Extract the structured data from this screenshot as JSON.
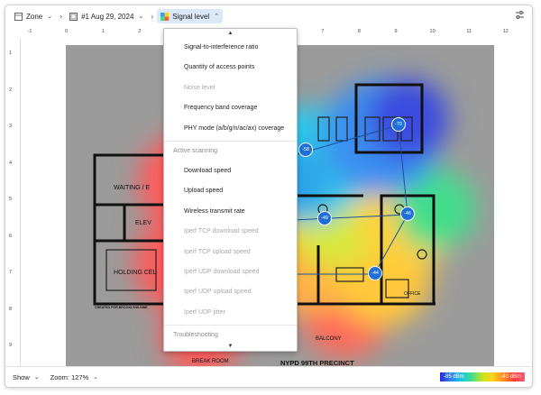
{
  "toolbar": {
    "zone_label": "Zone",
    "plan_label": "#1 Aug 29, 2024",
    "layer_label": "Signal level"
  },
  "ruler": {
    "x_ticks": [
      "-1",
      "0",
      "1",
      "2",
      "3",
      "4",
      "5",
      "6",
      "7",
      "8",
      "9",
      "10",
      "11",
      "12"
    ],
    "y_ticks": [
      "1",
      "2",
      "3",
      "4",
      "5",
      "6",
      "7",
      "8",
      "9"
    ]
  },
  "dropdown": {
    "items_top": [
      {
        "label": "Signal-to-interference ratio",
        "enabled": true
      },
      {
        "label": "Quantity of access points",
        "enabled": true
      },
      {
        "label": "Noise level",
        "enabled": false
      },
      {
        "label": "Frequency band coverage",
        "enabled": true
      },
      {
        "label": "PHY mode (a/b/g/n/ac/ax) coverage",
        "enabled": true
      }
    ],
    "section_active": "Active scanning",
    "items_active": [
      {
        "label": "Download speed",
        "enabled": true
      },
      {
        "label": "Upload speed",
        "enabled": true
      },
      {
        "label": "Wireless transmit rate",
        "enabled": true
      },
      {
        "label": "Iperf TCP download speed",
        "enabled": false
      },
      {
        "label": "Iperf TCP upload speed",
        "enabled": false
      },
      {
        "label": "Iperf UDP download speed",
        "enabled": false
      },
      {
        "label": "Iperf UDP upload speed",
        "enabled": false
      },
      {
        "label": "Iperf UDP jitter",
        "enabled": false
      }
    ],
    "section_troubleshooting": "Troubleshooting"
  },
  "access_points": [
    "-70",
    "-58",
    "-49",
    "-46",
    "-44"
  ],
  "floorplan_labels": {
    "waiting": "WAITING / E",
    "elev": "ELEV",
    "holding": "HOLDING CEL",
    "created": "CREATED FOR BROOKLYN9-NINE",
    "office": "OFFICE",
    "balcony": "BALCONY",
    "precinct": "NYPD 99TH PRECINCT",
    "break": "BREAK ROOM"
  },
  "status": {
    "show_label": "Show",
    "zoom_label": "Zoom: 127%"
  },
  "legend": {
    "min": "-85 dBm",
    "max": "-40 dBm"
  }
}
